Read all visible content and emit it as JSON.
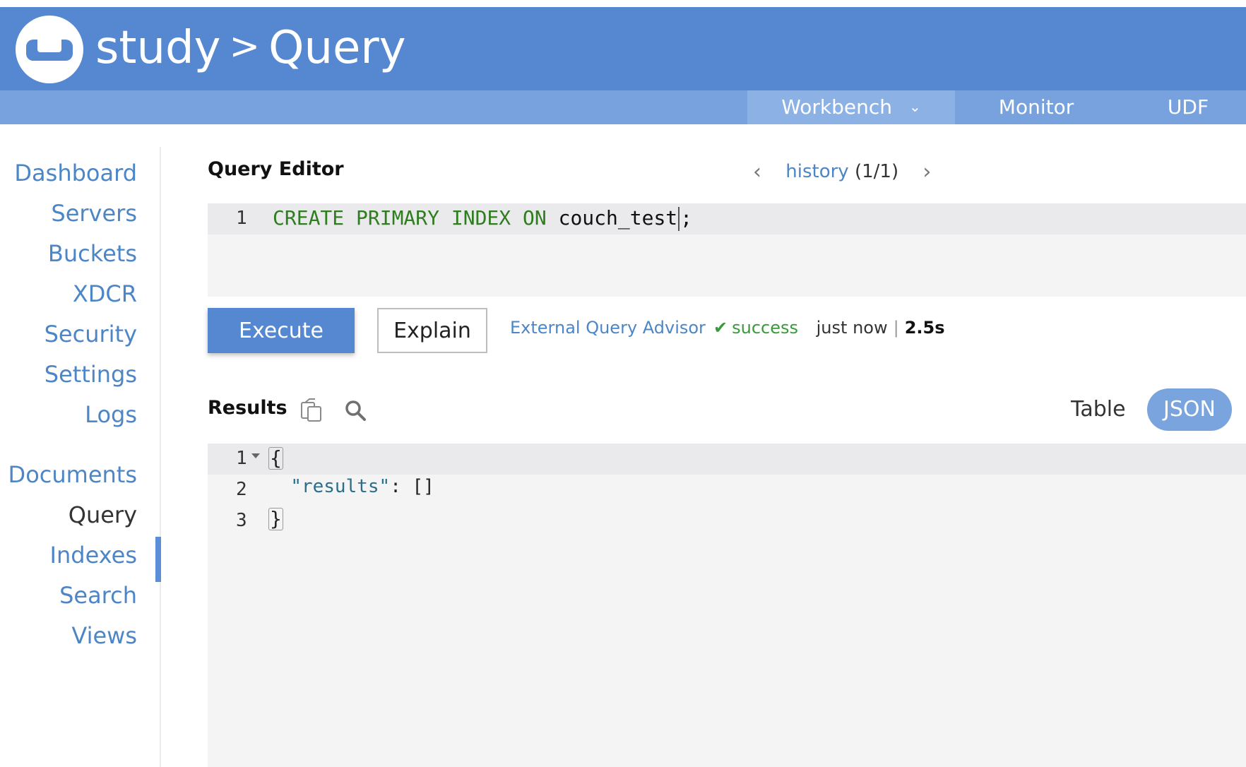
{
  "header": {
    "bucket": "study",
    "separator": ">",
    "page": "Query",
    "bg_color": "#5588d1"
  },
  "subnav": {
    "workbench": "Workbench",
    "workbench_chevron": "⌄",
    "monitor": "Monitor",
    "udf": "UDF"
  },
  "sidebar": {
    "items": [
      {
        "label": "Dashboard"
      },
      {
        "label": "Servers"
      },
      {
        "label": "Buckets"
      },
      {
        "label": "XDCR"
      },
      {
        "label": "Security"
      },
      {
        "label": "Settings"
      },
      {
        "label": "Logs"
      },
      {
        "label": "Documents"
      },
      {
        "label": "Query",
        "active": true
      },
      {
        "label": "Indexes"
      },
      {
        "label": "Search"
      },
      {
        "label": "Views"
      }
    ]
  },
  "editor": {
    "title": "Query Editor",
    "history_prev": "‹",
    "history_link": "history",
    "history_count": "(1/1)",
    "history_next": "›",
    "line_number": "1",
    "keywords": "CREATE PRIMARY INDEX ON",
    "identifier": "couch_test",
    "terminator": ";"
  },
  "actions": {
    "execute": "Execute",
    "explain": "Explain",
    "advisor": "External Query Advisor",
    "status_text": "success",
    "status_time": "just now",
    "status_sep": "|",
    "duration": "2.5s",
    "success_color": "#3a9a3a"
  },
  "results": {
    "title": "Results",
    "view_table": "Table",
    "view_json": "JSON",
    "lines": [
      {
        "num": "1",
        "text": "{"
      },
      {
        "num": "2",
        "key": "\"results\"",
        "colon": ":",
        "value": "[]"
      },
      {
        "num": "3",
        "text": "}"
      }
    ]
  }
}
